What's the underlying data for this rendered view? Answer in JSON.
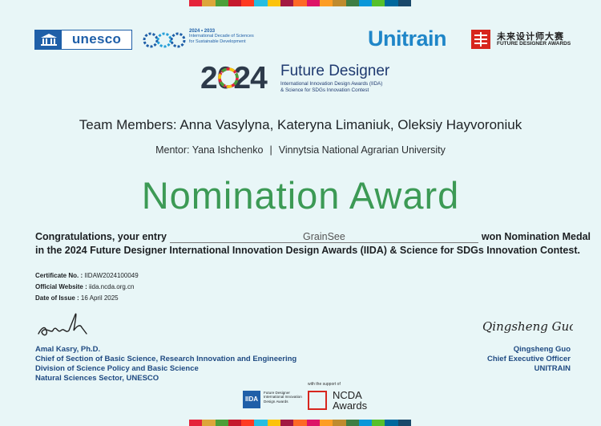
{
  "header": {
    "unesco_label": "unesco",
    "decade_year": "2024 • 2033",
    "decade_text": "International Decade of Sciences for Sustainable Development",
    "unitrain_label": "Unitrain",
    "fda_zh": "未来设计师大赛",
    "fda_en": "FUTURE DESIGNER AWARDS"
  },
  "emblem": {
    "year": "2024",
    "title": "Future Designer",
    "subtitle_1": "International Innovation Design Awards (IIDA)",
    "subtitle_2": "& Science for SDGs Innovation Contest"
  },
  "recipient": {
    "team": "Team Members: Anna Vasylyna, Kateryna Limaniuk, Oleksiy Hayvoroniuk",
    "mentor": "Mentor: Yana Ishchenko",
    "separator": "|",
    "institution": "Vinnytsia National Agrarian University"
  },
  "award_title": "Nomination Award",
  "body": {
    "prefix": "Congratulations, your entry",
    "entry_name": "GrainSee",
    "suffix": "won Nomination Medal",
    "line2": "in the 2024 Future Designer International Innovation Design Awards (IIDA) & Science for SDGs Innovation Contest."
  },
  "meta": {
    "certificate_label": "Certificate No. :",
    "certificate_value": "IIDAW2024100049",
    "website_label": "Official Website :",
    "website_value": "iida.ncda.org.cn",
    "date_label": "Date of Issue :",
    "date_value": "16 April 2025"
  },
  "signer_left": {
    "name": "Amal Kasry, Ph.D.",
    "line1": "Chief of Section of Basic Science, Research Innovation and Engineering",
    "line2": "Division of Science Policy and Basic Science",
    "line3": "Natural Sciences Sector, UNESCO"
  },
  "signer_right": {
    "signature_text": "Qingsheng Guo",
    "name": "Qingsheng Guo",
    "title": "Chief Executive Officer",
    "org": "UNITRAIN"
  },
  "footer": {
    "iida_mark": "IIDA",
    "iida_text": "Future Designer International Innovation Design Awards",
    "support_text": "with the support of",
    "ncda_line1": "NCDA",
    "ncda_line2": "Awards"
  },
  "colors": {
    "background": "#e8f6f7",
    "award_green": "#3c9a55",
    "signer_blue": "#1f4a82",
    "unesco_blue": "#1f5fa8",
    "unitrain_blue": "#1f86c8",
    "brand_red": "#d7261e",
    "sdg_colors": [
      "#e5243b",
      "#dda63a",
      "#4c9f38",
      "#c5192d",
      "#ff3a21",
      "#26bde2",
      "#fcc30b",
      "#a21942",
      "#fd6925",
      "#dd1367",
      "#fd9d24",
      "#bf8b2e",
      "#3f7e44",
      "#0a97d9",
      "#56c02b",
      "#00689d",
      "#19486a"
    ]
  }
}
